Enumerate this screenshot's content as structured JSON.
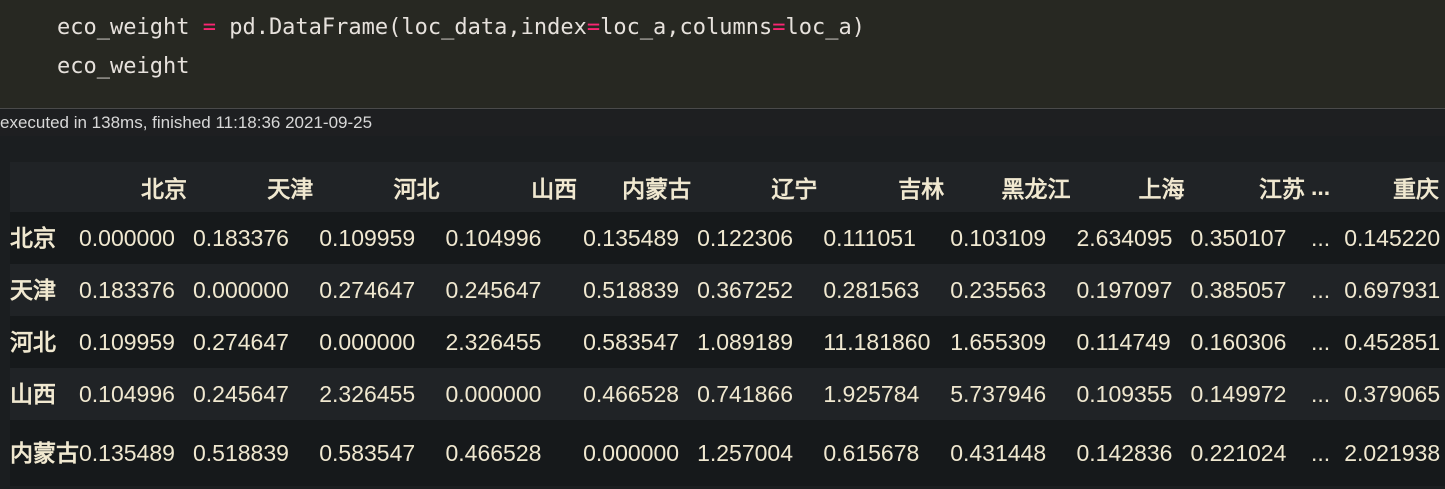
{
  "code": {
    "line1": {
      "var": "eco_weight",
      "op": "=",
      "expr_a": "pd.DataFrame(loc_data,index",
      "op2": "=",
      "expr_b": "loc_a,columns",
      "op3": "=",
      "expr_c": "loc_a)"
    },
    "line2": "eco_weight"
  },
  "status": {
    "text": "executed in 138ms, finished 11:18:36 2021-09-25"
  },
  "table": {
    "columns": [
      "北京",
      "天津",
      "河北",
      "山西",
      "内蒙古",
      "辽宁",
      "吉林",
      "黑龙江",
      "上海",
      "江苏",
      "...",
      "重庆"
    ],
    "rows": [
      {
        "index": "北京",
        "values": [
          "0.000000",
          "0.183376",
          "0.109959",
          "0.104996",
          "0.135489",
          "0.122306",
          "0.111051",
          "0.103109",
          "2.634095",
          "0.350107",
          "...",
          "0.145220"
        ]
      },
      {
        "index": "天津",
        "values": [
          "0.183376",
          "0.000000",
          "0.274647",
          "0.245647",
          "0.518839",
          "0.367252",
          "0.281563",
          "0.235563",
          "0.197097",
          "0.385057",
          "...",
          "0.697931"
        ]
      },
      {
        "index": "河北",
        "values": [
          "0.109959",
          "0.274647",
          "0.000000",
          "2.326455",
          "0.583547",
          "1.089189",
          "11.181860",
          "1.655309",
          "0.114749",
          "0.160306",
          "...",
          "0.452851"
        ]
      },
      {
        "index": "山西",
        "values": [
          "0.104996",
          "0.245647",
          "2.326455",
          "0.000000",
          "0.466528",
          "0.741866",
          "1.925784",
          "5.737946",
          "0.109355",
          "0.149972",
          "...",
          "0.379065"
        ]
      },
      {
        "index": "内蒙古",
        "values": [
          "0.135489",
          "0.518839",
          "0.583547",
          "0.466528",
          "0.000000",
          "1.257004",
          "0.615678",
          "0.431448",
          "0.142836",
          "0.221024",
          "...",
          "2.021938"
        ]
      }
    ]
  }
}
